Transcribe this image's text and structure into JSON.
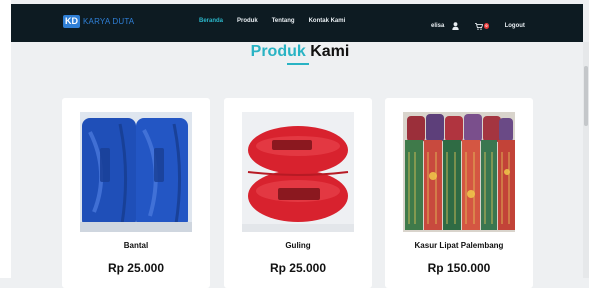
{
  "brand": {
    "badge": "KD",
    "name": "KARYA DUTA"
  },
  "nav": {
    "items": [
      {
        "label": "Beranda",
        "active": true
      },
      {
        "label": "Produk",
        "active": false
      },
      {
        "label": "Tentang",
        "active": false
      },
      {
        "label": "Kontak Kami",
        "active": false
      }
    ]
  },
  "user": {
    "name": "elisa",
    "icon": "user-icon"
  },
  "cart": {
    "icon": "cart-icon",
    "count": "0"
  },
  "logout_label": "Logout",
  "section": {
    "title_part1": "Produk",
    "title_part2": "Kami"
  },
  "products": [
    {
      "name": "Bantal",
      "price": "Rp 25.000",
      "image": "pillow-product-image"
    },
    {
      "name": "Guling",
      "price": "Rp 25.000",
      "image": "bolster-product-image"
    },
    {
      "name": "Kasur Lipat Palembang",
      "price": "Rp 150.000",
      "image": "folding-mattress-product-image"
    }
  ],
  "colors": {
    "navbar": "#0d1b22",
    "accent": "#29b3c4",
    "brand": "#2f7fd6",
    "cart_badge": "#e63b3b"
  }
}
